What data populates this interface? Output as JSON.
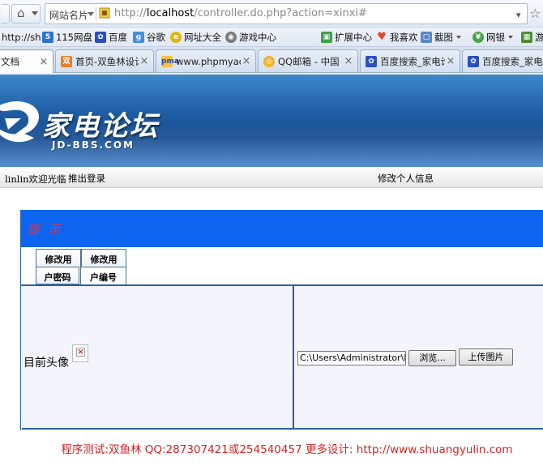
{
  "browser": {
    "site_name": "网站名片",
    "url_prefix": "http://",
    "url_host": "localhost",
    "url_path": "/controller.do.php?action=xinxi#",
    "bookmarks": [
      {
        "label": "http://sh",
        "icon": "none"
      },
      {
        "label": "115网盘",
        "icon": "115-icon"
      },
      {
        "label": "百度",
        "icon": "baidu-paw-icon"
      },
      {
        "label": "谷歌",
        "icon": "google-icon"
      },
      {
        "label": "网址大全",
        "icon": "globe-icon"
      },
      {
        "label": "游戏中心",
        "icon": "gamepad-icon"
      },
      {
        "label": "扩展中心",
        "icon": "extension-icon"
      },
      {
        "label": "我喜欢",
        "icon": "heart-icon"
      },
      {
        "label": "截图",
        "icon": "screenshot-icon"
      },
      {
        "label": "网银",
        "icon": "bank-icon"
      },
      {
        "label": "游",
        "icon": "grid-icon"
      }
    ],
    "tabs": [
      {
        "label": "文档",
        "active": true
      },
      {
        "label": "首页-双鱼林设计",
        "active": false
      },
      {
        "label": "www.phpmyadmin",
        "active": false
      },
      {
        "label": "QQ邮箱 - 中国",
        "active": false
      },
      {
        "label": "百度搜索_家电论坛",
        "active": false
      },
      {
        "label": "百度搜索_家电论坛",
        "active": false
      }
    ]
  },
  "banner": {
    "logo_text": "家电论坛",
    "logo_sub": "JD-BBS.COM"
  },
  "userbar": {
    "welcome": "linlin欢迎光临",
    "logout": "推出登录",
    "edit_info": "修改个人信息"
  },
  "panel": {
    "title": "提 示",
    "tabs": [
      "修改用",
      "修改用",
      "户密码",
      "户编号"
    ]
  },
  "form": {
    "avatar_label": "目前头像",
    "file_path": "C:\\Users\\Administrator\\Desktop",
    "browse_label": "浏览...",
    "upload_label": "上传图片"
  },
  "footer": {
    "text": "程序测试:双鱼林 QQ:287307421或254540457 更多设计: http://www.shuangyulin.com"
  },
  "colors": {
    "panel_header": "#0d64f0",
    "panel_title": "#ff2a2a",
    "footer_text": "#d42222",
    "banner_blue": "#1f5ea5"
  }
}
